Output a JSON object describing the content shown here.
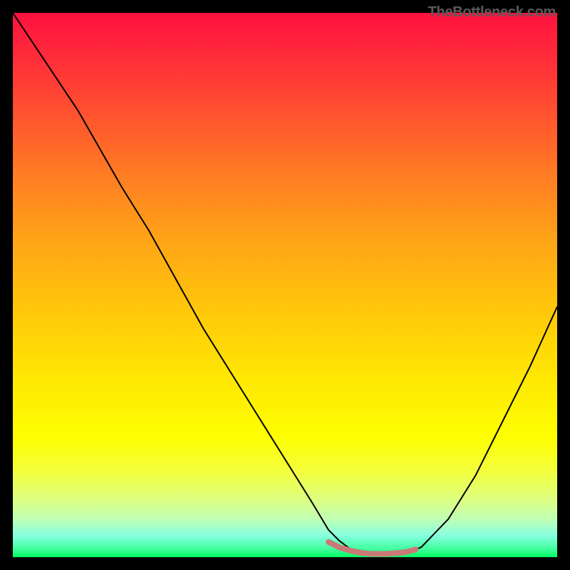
{
  "watermark": "TheBottleneck.com",
  "chart_data": {
    "type": "line",
    "title": "",
    "xlabel": "",
    "ylabel": "",
    "xlim": [
      0,
      100
    ],
    "ylim": [
      0,
      100
    ],
    "background_gradient": {
      "orientation": "vertical",
      "stops": [
        {
          "pos": 0,
          "color": "#ff113f"
        },
        {
          "pos": 8,
          "color": "#ff2c3a"
        },
        {
          "pos": 18,
          "color": "#ff5030"
        },
        {
          "pos": 30,
          "color": "#ff7d23"
        },
        {
          "pos": 42,
          "color": "#ffa516"
        },
        {
          "pos": 55,
          "color": "#ffc80a"
        },
        {
          "pos": 67,
          "color": "#ffe704"
        },
        {
          "pos": 78,
          "color": "#feff00"
        },
        {
          "pos": 84,
          "color": "#f3ff3a"
        },
        {
          "pos": 89,
          "color": "#e0ff7c"
        },
        {
          "pos": 93,
          "color": "#c0ffb5"
        },
        {
          "pos": 96,
          "color": "#88ffe0"
        },
        {
          "pos": 98.5,
          "color": "#40ff9e"
        },
        {
          "pos": 100,
          "color": "#00ff60"
        }
      ]
    },
    "series": [
      {
        "name": "bottleneck-curve",
        "color": "#000000",
        "stroke_width": 2,
        "x": [
          0,
          4,
          8,
          12,
          16,
          20,
          25,
          30,
          35,
          40,
          45,
          50,
          55,
          58,
          60,
          62,
          64,
          67,
          70,
          72,
          75,
          80,
          85,
          90,
          95,
          100
        ],
        "y": [
          100,
          94,
          88,
          82,
          75,
          68,
          60,
          51,
          42,
          34,
          26,
          18,
          10,
          5,
          3,
          1.5,
          0.8,
          0.6,
          0.6,
          0.8,
          1.8,
          7,
          15,
          25,
          35,
          46
        ]
      },
      {
        "name": "optimal-plateau-highlight",
        "color": "#c97a78",
        "stroke_width": 8,
        "x": [
          58,
          60,
          62,
          64,
          66,
          68,
          70,
          72,
          74
        ],
        "y": [
          2.8,
          1.8,
          1.2,
          0.8,
          0.6,
          0.6,
          0.7,
          0.9,
          1.4
        ]
      }
    ],
    "annotations": []
  }
}
